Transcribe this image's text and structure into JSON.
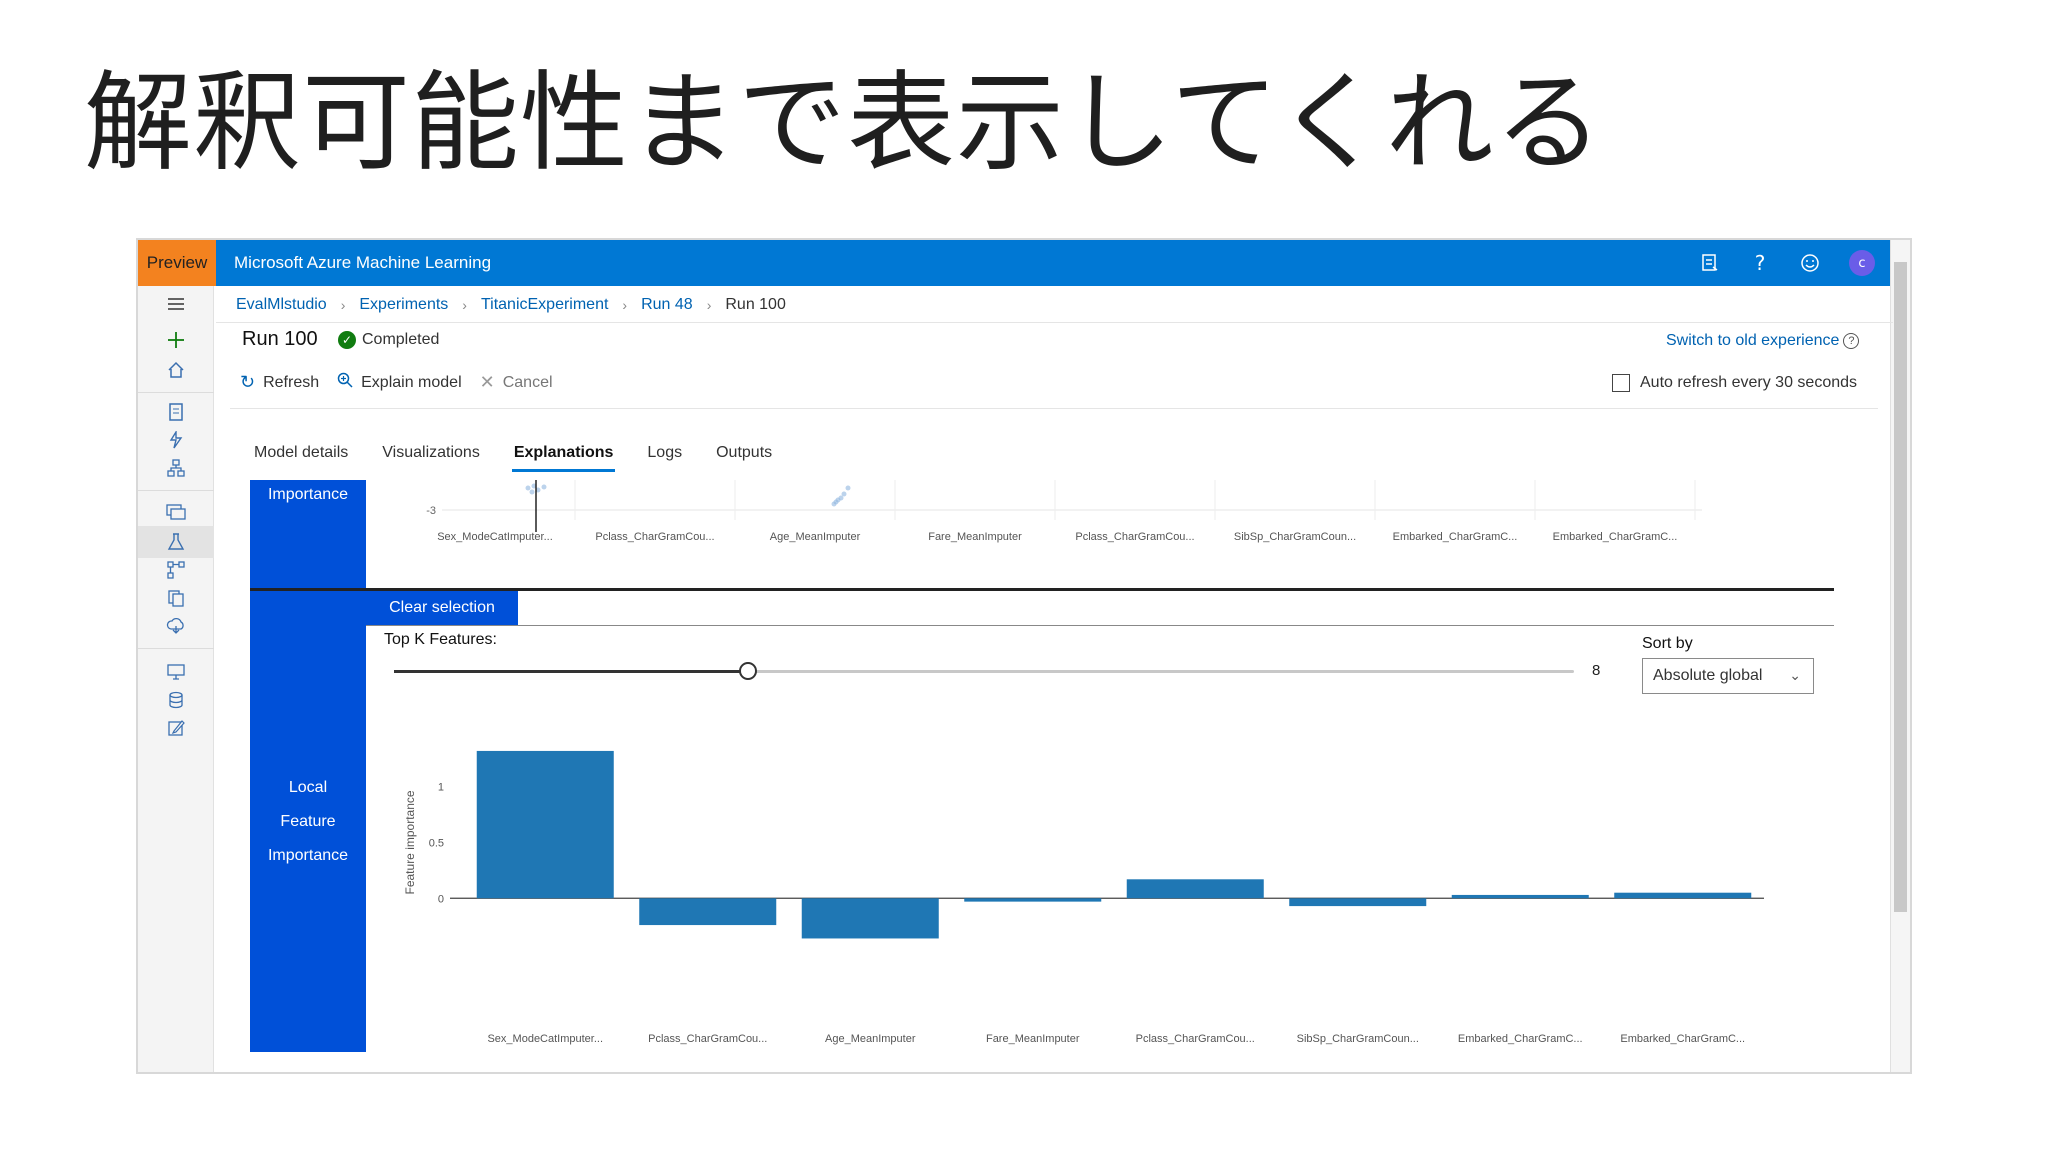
{
  "slide": {
    "title": "解釈可能性まで表示してくれる"
  },
  "topbar": {
    "preview_label": "Preview",
    "app_title": "Microsoft Azure Machine Learning",
    "avatar_initial": "c"
  },
  "breadcrumb": [
    "EvalMlstudio",
    "Experiments",
    "TitanicExperiment",
    "Run 48",
    "Run 100"
  ],
  "run": {
    "title": "Run 100",
    "status": "Completed",
    "switch_link": "Switch to old experience"
  },
  "commands": {
    "refresh": "Refresh",
    "explain": "Explain model",
    "cancel": "Cancel",
    "auto_refresh": "Auto refresh every 30 seconds"
  },
  "tabs": [
    "Model details",
    "Visualizations",
    "Explanations",
    "Logs",
    "Outputs"
  ],
  "active_tab": "Explanations",
  "panel": {
    "top_label": "Importance",
    "local_label_lines": [
      "Local",
      "Feature",
      "Importance"
    ],
    "clear_selection": "Clear selection",
    "topk_label": "Top K Features:",
    "topk_value": "8",
    "topk_fraction": 0.3,
    "sortby_label": "Sort by",
    "sortby_value": "Absolute global"
  },
  "colors": {
    "topbar": "#0078d4",
    "preview": "#f3821f",
    "panel_blue": "#0050d8",
    "bar": "#1f77b4",
    "completed": "#107c10"
  },
  "chart_data": [
    {
      "type": "scatter",
      "ytick": "-3",
      "categories": [
        "Sex_ModeCatImputer...",
        "Pclass_CharGramCou...",
        "Age_MeanImputer",
        "Fare_MeanImputer",
        "Pclass_CharGramCou...",
        "SibSp_CharGramCoun...",
        "Embarked_CharGramC...",
        "Embarked_CharGramC..."
      ]
    },
    {
      "type": "bar",
      "ylabel": "Feature importance",
      "ylim": [
        -0.75,
        1.4
      ],
      "yticks": [
        "1",
        "0.5",
        "0"
      ],
      "categories": [
        "Sex_ModeCatImputer...",
        "Pclass_CharGramCou...",
        "Age_MeanImputer",
        "Fare_MeanImputer",
        "Pclass_CharGramCou...",
        "SibSp_CharGramCoun...",
        "Embarked_CharGramC...",
        "Embarked_CharGramC..."
      ],
      "values": [
        1.32,
        -0.24,
        -0.36,
        -0.03,
        0.17,
        -0.07,
        0.03,
        0.05
      ]
    }
  ]
}
